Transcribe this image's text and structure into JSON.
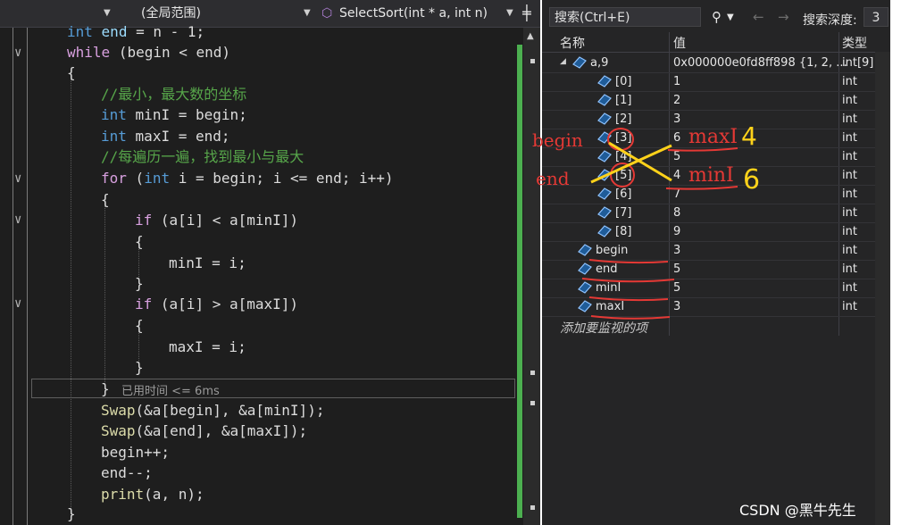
{
  "editor": {
    "nav": {
      "scope": "(全局范围)",
      "function": "SelectSort(int * a, int n)"
    },
    "elapsed": "已用时间 <= 6ms"
  },
  "watch": {
    "search_placeholder": "搜索(Ctrl+E)",
    "depth_label": "搜索深度:",
    "depth_value": "3",
    "columns": {
      "name": "名称",
      "value": "值",
      "type": "类型"
    },
    "rows": [
      {
        "name": "a,9",
        "value": "0x000000e0fd8ff898 {1, 2, ...",
        "type": "int[9]",
        "expanded": true
      },
      {
        "name": "[0]",
        "value": "1",
        "type": "int"
      },
      {
        "name": "[1]",
        "value": "2",
        "type": "int"
      },
      {
        "name": "[2]",
        "value": "3",
        "type": "int"
      },
      {
        "name": "[3]",
        "value": "6",
        "type": "int"
      },
      {
        "name": "[4]",
        "value": "5",
        "type": "int"
      },
      {
        "name": "[5]",
        "value": "4",
        "type": "int"
      },
      {
        "name": "[6]",
        "value": "7",
        "type": "int"
      },
      {
        "name": "[7]",
        "value": "8",
        "type": "int"
      },
      {
        "name": "[8]",
        "value": "9",
        "type": "int"
      },
      {
        "name": "begin",
        "value": "3",
        "type": "int"
      },
      {
        "name": "end",
        "value": "5",
        "type": "int"
      },
      {
        "name": "minI",
        "value": "5",
        "type": "int"
      },
      {
        "name": "maxI",
        "value": "3",
        "type": "int"
      }
    ],
    "add_item": "添加要监视的项"
  },
  "annotations": {
    "begin": "begin",
    "end": "end",
    "maxI": "maxI",
    "minI": "minI",
    "four": "4",
    "six": "6"
  },
  "watermark": "CSDN @黑牛先生",
  "colors": {
    "annotation_red": "#e53935",
    "annotation_yellow": "#ffd21a",
    "change_bar": "#4caf50"
  }
}
